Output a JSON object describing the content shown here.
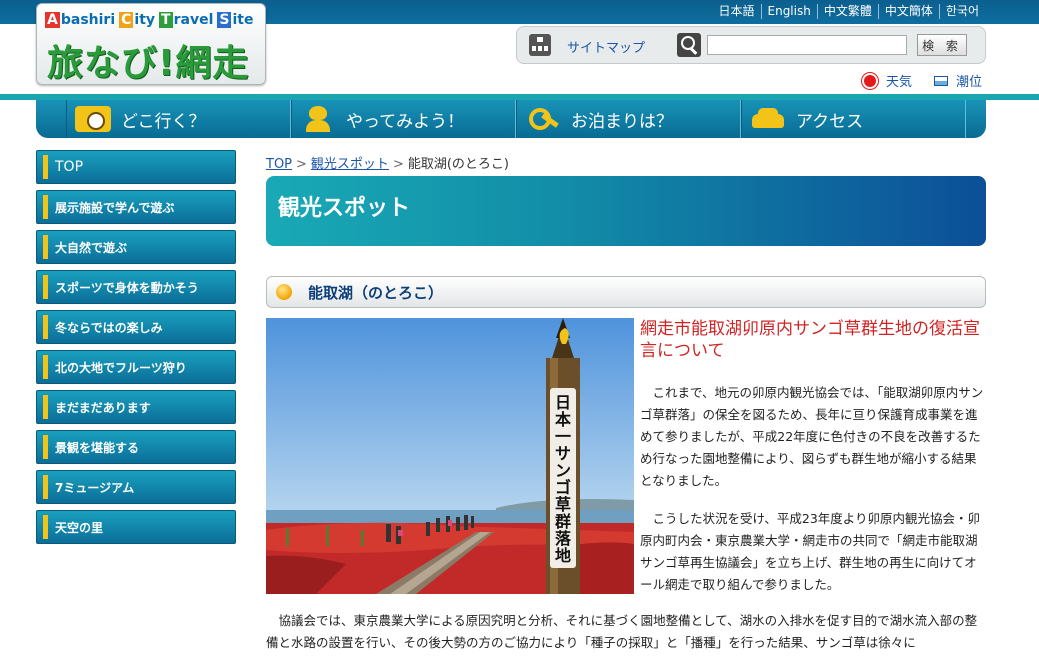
{
  "languages": [
    "日本語",
    "English",
    "中文繁體",
    "中文簡体",
    "한국어"
  ],
  "logo": {
    "subtitle_letters": [
      {
        "cap": "A",
        "rest": "bashiri",
        "color": "#e4342b"
      },
      {
        "cap": "C",
        "rest": "ity",
        "color": "#f0a21b"
      },
      {
        "cap": "T",
        "rest": "ravel",
        "color": "#2e9d3a"
      },
      {
        "cap": "S",
        "rest": "ite",
        "color": "#2a6fd0"
      }
    ],
    "main": "旅なび!網走"
  },
  "search": {
    "sitemap_label": "サイトマップ",
    "placeholder": "",
    "button_label": "検 索"
  },
  "util": {
    "weather": "天気",
    "tide": "潮位"
  },
  "gnav": [
    {
      "label": "どこ行く？",
      "icon": "camera-icon"
    },
    {
      "label": "やってみよう！",
      "icon": "person-icon"
    },
    {
      "label": "お泊まりは？",
      "icon": "key-icon"
    },
    {
      "label": "アクセス",
      "icon": "car-icon"
    }
  ],
  "sidebar": [
    "TOP",
    "展示施設で学んで遊ぶ",
    "大自然で遊ぶ",
    "スポーツで身体を動かそう",
    "冬ならではの楽しみ",
    "北の大地でフルーツ狩り",
    "まだまだあります",
    "景観を堪能する",
    "7ミュージアム",
    "天空の里"
  ],
  "breadcrumb": {
    "top": "TOP",
    "spots": "観光スポット",
    "current": "能取湖(のとろこ)"
  },
  "page_title": "観光スポット",
  "section_title": "能取湖（のとろこ）",
  "photo": {
    "signpost_text": "日本一サンゴ草群落地"
  },
  "article": {
    "heading": "網走市能取湖卯原内サンゴ草群生地の復活宣言について",
    "para1": "これまで、地元の卯原内観光協会では、「能取湖卯原内サンゴ草群落」の保全を図るため、長年に亘り保護育成事業を進めて参りましたが、平成22年度に色付きの不良を改善するため行なった園地整備により、図らずも群生地が縮小する結果となりました。",
    "para2": "こうした状況を受け、平成23年度より卯原内観光協会・卯原内町内会・東京農業大学・網走市の共同で「網走市能取湖サンゴ草再生協議会」を立ち上げ、群生地の再生に向けてオール網走で取り組んで参りました。",
    "para3": "協議会では、東京農業大学による原因究明と分析、それに基づく園地整備として、湖水の入排水を促す目的で湖水流入部の整備と水路の設置を行い、その後大勢の方のご協力により「種子の採取」と「播種」を行った結果、サンゴ草は徐々に"
  }
}
